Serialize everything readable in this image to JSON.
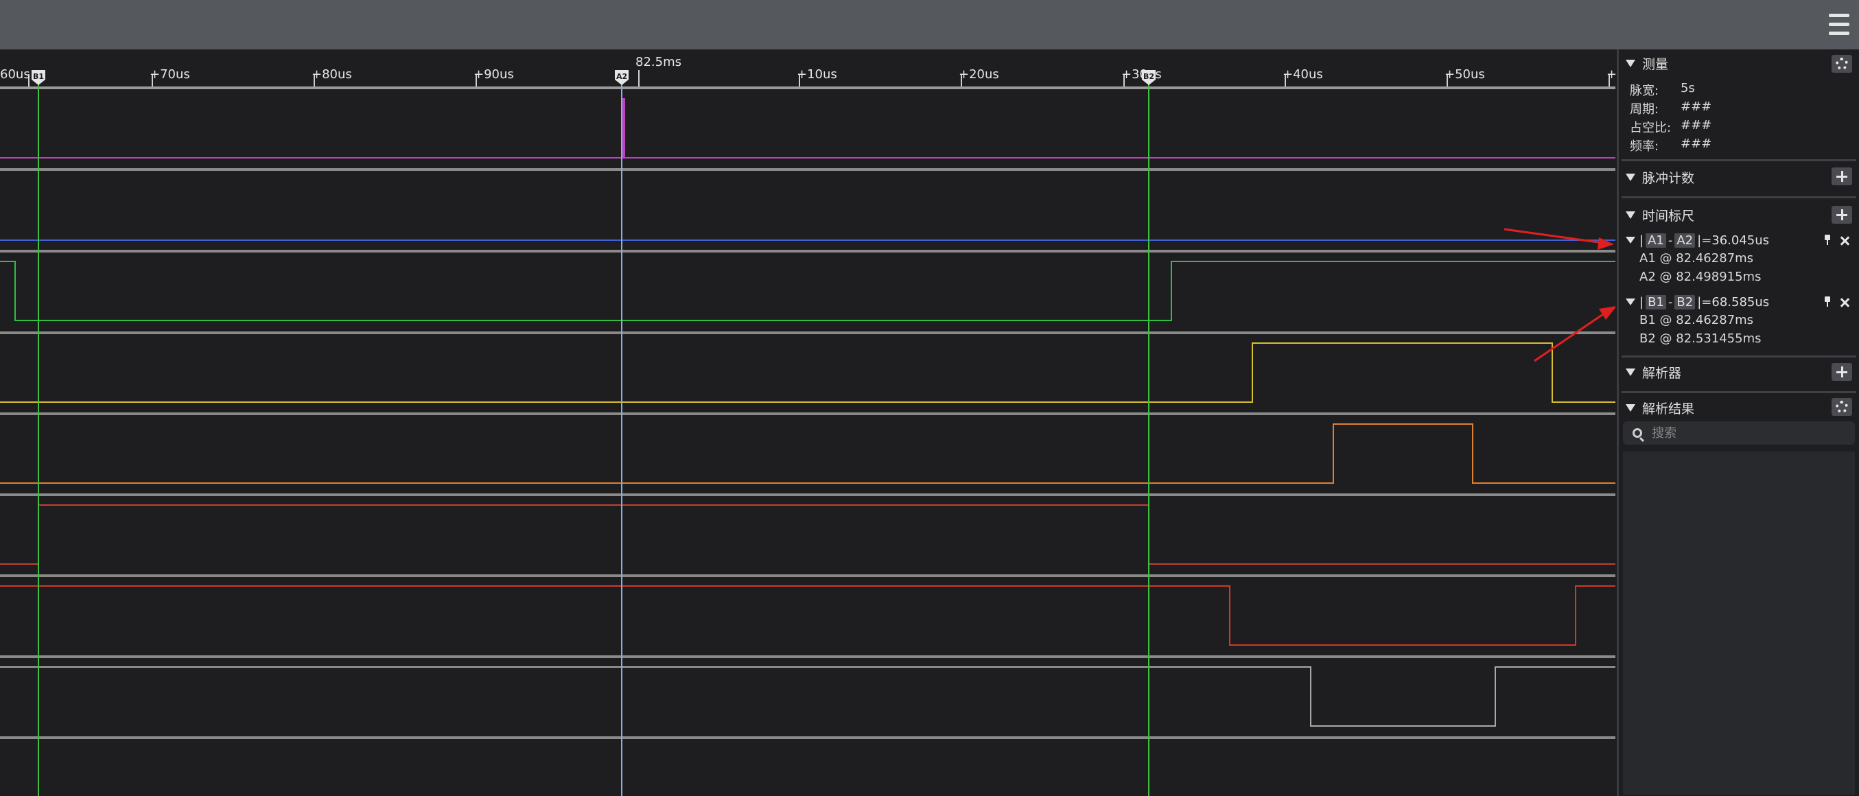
{
  "timebar": {
    "ticks": [
      "60us",
      "+70us",
      "+80us",
      "+90us",
      "+10us",
      "+20us",
      "+30us",
      "+40us",
      "+50us",
      "+"
    ],
    "center_label": "82.5ms",
    "cursors": [
      "B1",
      "A2",
      "B2"
    ]
  },
  "panel": {
    "measure": {
      "title": "测量",
      "rows": [
        {
          "key": "脉宽:",
          "value": "5s"
        },
        {
          "key": "周期:",
          "value": "###"
        },
        {
          "key": "占空比:",
          "value": "###"
        },
        {
          "key": "频率:",
          "value": "###"
        }
      ]
    },
    "pulse_count": {
      "title": "脉冲计数"
    },
    "time_ruler": {
      "title": "时间标尺",
      "rulers": [
        {
          "a": "A1",
          "b": "A2",
          "value": "=36.045us",
          "line1": "A1 @ 82.46287ms",
          "line2": "A2 @ 82.498915ms"
        },
        {
          "a": "B1",
          "b": "B2",
          "value": "=68.585us",
          "line1": "B1 @ 82.46287ms",
          "line2": "B2 @ 82.531455ms"
        }
      ]
    },
    "decoder": {
      "title": "解析器"
    },
    "decode_results": {
      "title": "解析结果",
      "search_placeholder": "搜索"
    }
  },
  "colors": {
    "ch0": "#c040c0",
    "ch1": "#4060d8",
    "ch2": "#30c040",
    "ch3": "#d8c030",
    "ch4": "#e08030",
    "ch5": "#c04030",
    "ch6": "#d03828",
    "ch7": "#a8a8a8",
    "cursor_b": "#40c040",
    "cursor_a": "#8ab0e0",
    "annotation_arrow": "#e02020"
  }
}
